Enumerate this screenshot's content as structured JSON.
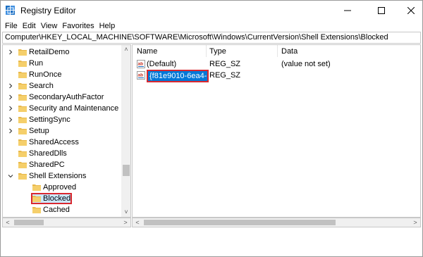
{
  "window": {
    "title": "Registry Editor"
  },
  "menu": [
    "File",
    "Edit",
    "View",
    "Favorites",
    "Help"
  ],
  "address": "Computer\\HKEY_LOCAL_MACHINE\\SOFTWARE\\Microsoft\\Windows\\CurrentVersion\\Shell Extensions\\Blocked",
  "tree": [
    {
      "label": "RetailDemo",
      "chevron": "right"
    },
    {
      "label": "Run",
      "chevron": "none"
    },
    {
      "label": "RunOnce",
      "chevron": "none"
    },
    {
      "label": "Search",
      "chevron": "right"
    },
    {
      "label": "SecondaryAuthFactor",
      "chevron": "right"
    },
    {
      "label": "Security and Maintenance",
      "chevron": "right"
    },
    {
      "label": "SettingSync",
      "chevron": "right"
    },
    {
      "label": "Setup",
      "chevron": "right"
    },
    {
      "label": "SharedAccess",
      "chevron": "none"
    },
    {
      "label": "SharedDlls",
      "chevron": "none"
    },
    {
      "label": "SharedPC",
      "chevron": "none"
    },
    {
      "label": "Shell Extensions",
      "chevron": "down"
    },
    {
      "label": "Approved",
      "chevron": "none",
      "child": true
    },
    {
      "label": "Blocked",
      "chevron": "none",
      "child": true,
      "selected": true
    },
    {
      "label": "Cached",
      "chevron": "none",
      "child": true
    }
  ],
  "columns": {
    "name": "Name",
    "type": "Type",
    "data": "Data"
  },
  "values": [
    {
      "name": "(Default)",
      "type": "REG_SZ",
      "data": "(value not set)"
    },
    {
      "name": "{f81e9010-6ea4-...",
      "type": "REG_SZ",
      "data": "",
      "editing": true
    }
  ],
  "colors": {
    "folder": "#e8b84a",
    "selection": "#cce8ff",
    "editing_highlight": "#0078d7",
    "annotation_border": "#d9282f"
  }
}
